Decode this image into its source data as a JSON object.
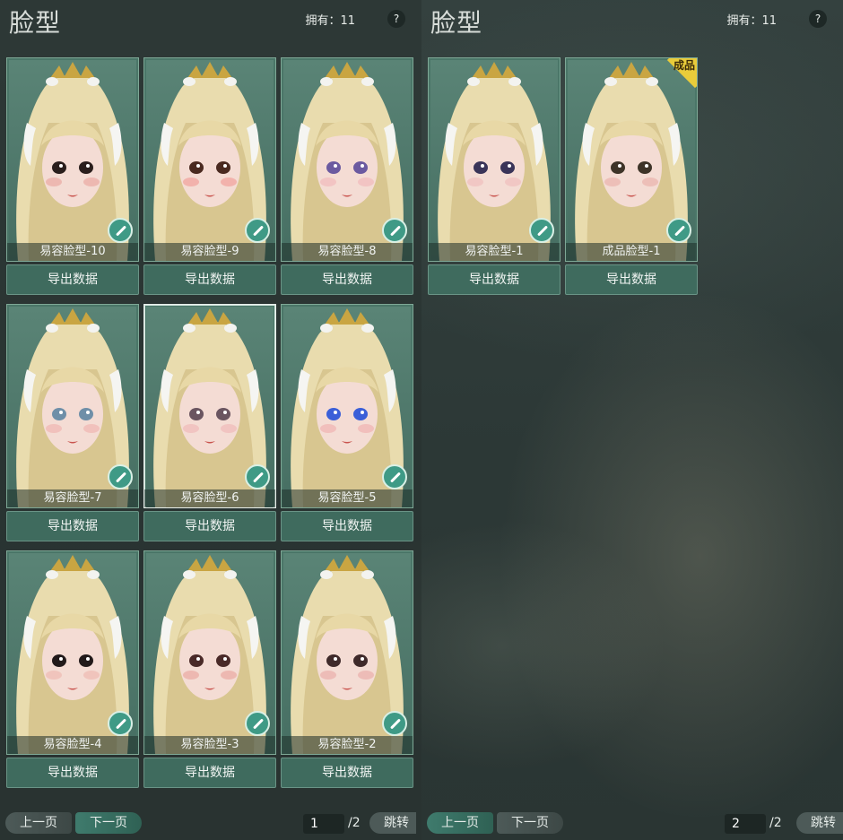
{
  "left_panel": {
    "title": "脸型",
    "owned": "拥有：11",
    "help": "?",
    "cards": [
      {
        "label": "易容脸型-10",
        "eye": "#2a1e1c",
        "blush": "#e79a94"
      },
      {
        "label": "易容脸型-9",
        "eye": "#4a2a20",
        "blush": "#f0908a"
      },
      {
        "label": "易容脸型-8",
        "eye": "#6b5aa0",
        "blush": "#f0b0b4"
      },
      {
        "label": "易容脸型-7",
        "eye": "#6f8fa8",
        "blush": "#efaca8"
      },
      {
        "label": "易容脸型-6",
        "eye": "#6a5560",
        "blush": "#efb0b0"
      },
      {
        "label": "易容脸型-5",
        "eye": "#3b5fd8",
        "blush": "#efa8a8"
      },
      {
        "label": "易容脸型-4",
        "eye": "#221a1a",
        "blush": "#ecb0a8"
      },
      {
        "label": "易容脸型-3",
        "eye": "#4a2a28",
        "blush": "#e89a94"
      },
      {
        "label": "易容脸型-2",
        "eye": "#3f2a2a",
        "blush": "#e8a29e"
      }
    ],
    "export_label": "导出数据",
    "prev_label": "上一页",
    "next_label": "下一页",
    "page": "1",
    "total": "/2",
    "jump_label": "跳转"
  },
  "right_panel": {
    "title": "脸型",
    "owned": "拥有：11",
    "help": "?",
    "cards": [
      {
        "label": "易容脸型-1",
        "eye": "#3a3458",
        "blush": "#efb6b6"
      },
      {
        "label": "成品脸型-1",
        "eye": "#3e3428",
        "blush": "#e8a8a0",
        "badge": "成品"
      }
    ],
    "export_label": "导出数据",
    "prev_label": "上一页",
    "next_label": "下一页",
    "page": "2",
    "total": "/2",
    "jump_label": "跳转"
  },
  "colors": {
    "card_bg": "#4a7668",
    "button_bg": "#3f6b5e",
    "badge": "#e9cc3a",
    "accent": "#3f9a86"
  },
  "icons": {
    "help": "question-mark-icon",
    "edit": "brush-icon",
    "badge": "finished-product-badge-icon"
  }
}
